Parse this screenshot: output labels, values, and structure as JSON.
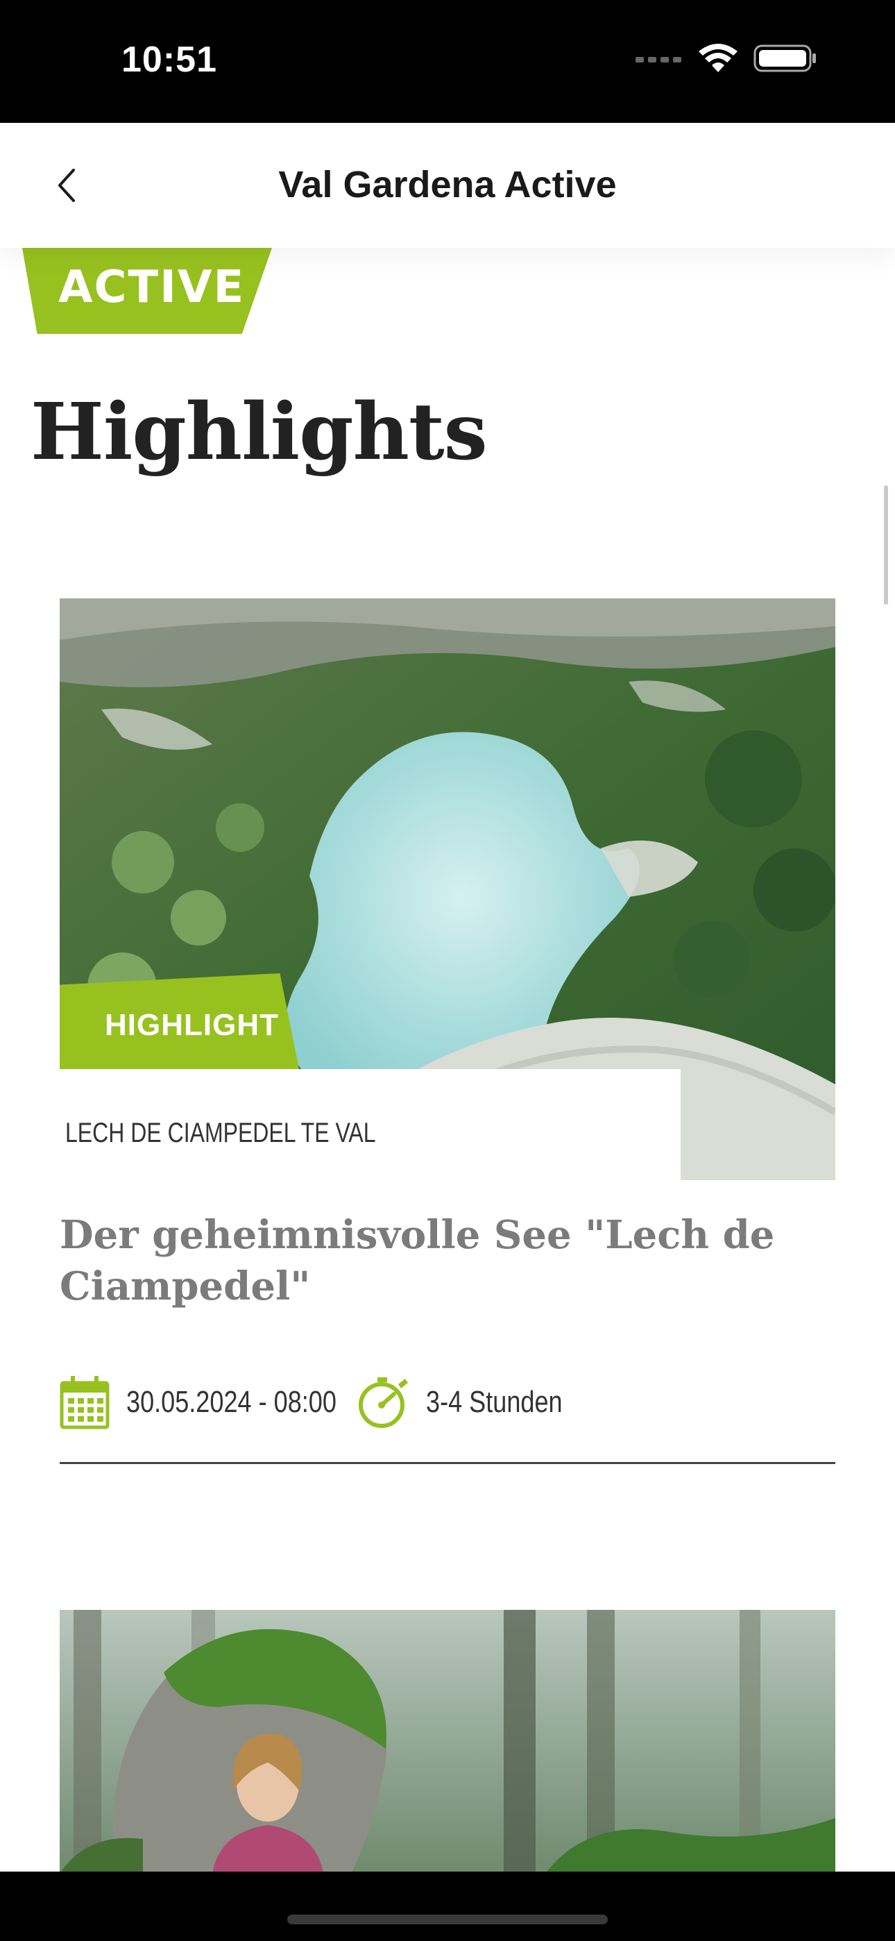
{
  "status": {
    "time": "10:51"
  },
  "nav": {
    "title": "Val Gardena Active"
  },
  "brand": {
    "badge_label": "ACTIVE",
    "accent_color": "#97c11f"
  },
  "section": {
    "title": "Highlights"
  },
  "cards": [
    {
      "badge": "HIGHLIGHT",
      "location": "LECH DE CIAMPEDEL TE VAL",
      "title": "Der geheimnisvolle See \"Lech de Ciampedel\"",
      "date": "30.05.2024 - 08:00",
      "duration": "3-4 Stunden"
    }
  ],
  "icons": {
    "back": "chevron-left-icon",
    "date": "calendar-icon",
    "duration": "stopwatch-icon",
    "signal": "cellular-signal-icon",
    "wifi": "wifi-icon",
    "battery": "battery-icon"
  }
}
